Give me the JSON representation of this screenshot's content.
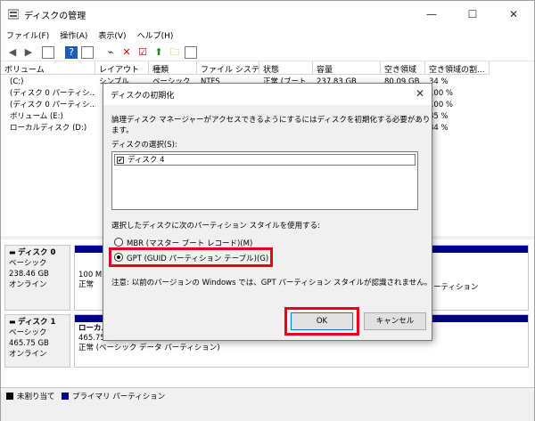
{
  "window": {
    "title": "ディスクの管理",
    "minimize": "—",
    "maximize": "☐",
    "close": "✕"
  },
  "menu": [
    "ファイル(F)",
    "操作(A)",
    "表示(V)",
    "ヘルプ(H)"
  ],
  "columns": [
    "ボリューム",
    "レイアウト",
    "種類",
    "ファイル システム",
    "状態",
    "容量",
    "空き領域",
    "空き領域の割..."
  ],
  "rows": [
    [
      "(C:)",
      "シンプル",
      "ベーシック",
      "NTFS",
      "正常 (ブート...",
      "237.83 GB",
      "80.09 GB",
      "34 %"
    ],
    [
      "(ディスク 0 パーティシ...",
      "",
      "",
      "",
      "",
      "",
      "",
      "100 %"
    ],
    [
      "(ディスク 0 パーティシ...",
      "",
      "",
      "",
      "",
      "",
      "",
      "100 %"
    ],
    [
      "ボリューム (E:)",
      "",
      "",
      "",
      "",
      "",
      "",
      "85 %"
    ],
    [
      "ローカルディスク (D:)",
      "",
      "",
      "",
      "",
      "",
      "",
      "84 %"
    ]
  ],
  "disk0": {
    "name": "ディスク 0",
    "type": "ベーシック",
    "size": "238.46 GB",
    "status": "オンライン",
    "part1_size": "100 M",
    "part1_status": "正常",
    "part_right_text": "ーティション"
  },
  "disk1": {
    "name": "ディスク 1",
    "type": "ベーシック",
    "size": "465.75 GB",
    "status": "オンライン",
    "part_name": "ローカル",
    "part_size": "465.75 GB NTFS",
    "part_status": "正常 (ベーシック データ パーティション)"
  },
  "legend": {
    "unalloc": "未割り当て",
    "primary": "プライマリ パーティション"
  },
  "dialog": {
    "title": "ディスクの初期化",
    "close": "✕",
    "message": "論理ディスク マネージャーがアクセスできるようにするにはディスクを初期化する必要があります。",
    "select_label": "ディスクの選択(S):",
    "disk_item": "ディスク 4",
    "check_mark": "✔",
    "style_label": "選択したディスクに次のパーティション スタイルを使用する:",
    "mbr": "MBR (マスター ブート レコード)(M)",
    "gpt": "GPT (GUID パーティション テーブル)(G)",
    "note": "注意: 以前のバージョンの Windows では、GPT パーティション スタイルが認識されません。",
    "ok": "OK",
    "cancel": "キャンセル"
  },
  "colors": {
    "highlight": "#e8001c",
    "primary": "#00008b"
  }
}
